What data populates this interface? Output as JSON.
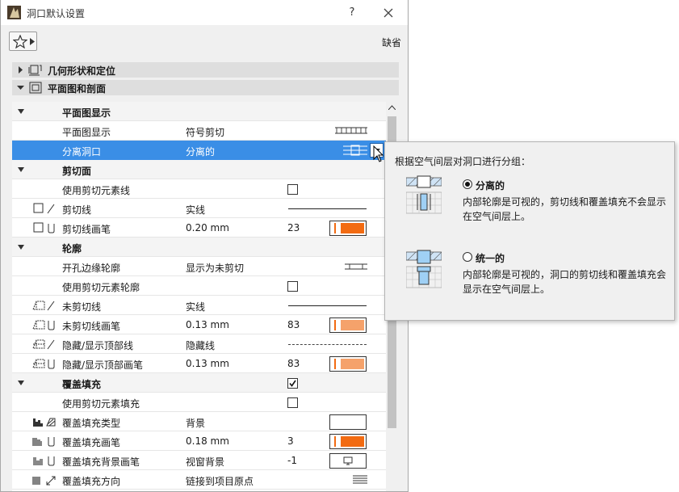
{
  "window": {
    "title": "洞口默认设置",
    "help_label": "?",
    "default_label": "缺省"
  },
  "panels": [
    {
      "label": "几何形状和定位",
      "expanded": false
    },
    {
      "label": "平面图和剖面",
      "expanded": true
    }
  ],
  "rows": [
    {
      "type": "section",
      "label": "平面图显示"
    },
    {
      "type": "item",
      "label": "平面图显示",
      "value": "符号剪切",
      "preview": "plan-symbol"
    },
    {
      "type": "item",
      "label": "分离洞口",
      "value": "分离的",
      "preview": "separate-dropdown",
      "selected": true
    },
    {
      "type": "section",
      "label": "剪切面"
    },
    {
      "type": "item",
      "label": "使用剪切元素线",
      "value": "",
      "checkbox": false
    },
    {
      "type": "item",
      "label": "剪切线",
      "value": "实线",
      "preview": "solid-line",
      "icon": "cut-line-icon"
    },
    {
      "type": "item",
      "label": "剪切线画笔",
      "value": "0.20 mm",
      "pen": "23",
      "swatch": "#f26b12",
      "icon": "cut-pen-icon"
    },
    {
      "type": "section",
      "label": "轮廓"
    },
    {
      "type": "item",
      "label": "开孔边缘轮廓",
      "value": "显示为未剪切",
      "preview": "edge-symbol"
    },
    {
      "type": "item",
      "label": "使用剪切元素轮廓",
      "value": "",
      "checkbox": false
    },
    {
      "type": "item",
      "label": "未剪切线",
      "value": "实线",
      "preview": "solid-line",
      "icon": "uncut-line-icon"
    },
    {
      "type": "item",
      "label": "未剪切线画笔",
      "value": "0.13 mm",
      "pen": "83",
      "swatch": "#f5a26b",
      "icon": "uncut-pen-icon"
    },
    {
      "type": "item",
      "label": "隐藏/显示顶部线",
      "value": "隐藏线",
      "preview": "dashed-line",
      "icon": "overhead-line-icon"
    },
    {
      "type": "item",
      "label": "隐藏/显示顶部画笔",
      "value": "0.13 mm",
      "pen": "83",
      "swatch": "#f5a26b",
      "icon": "overhead-pen-icon"
    },
    {
      "type": "section",
      "label": "覆盖填充",
      "checkbox": true
    },
    {
      "type": "item",
      "label": "使用剪切元素填充",
      "value": "",
      "checkbox": false
    },
    {
      "type": "item",
      "label": "覆盖填充类型",
      "value": "背景",
      "preview": "empty-box",
      "icon": "fill-type-icon"
    },
    {
      "type": "item",
      "label": "覆盖填充画笔",
      "value": "0.18 mm",
      "pen": "3",
      "swatch": "#f26b12",
      "icon": "fill-pen-icon"
    },
    {
      "type": "item",
      "label": "覆盖填充背景画笔",
      "value": "视窗背景",
      "pen": "-1",
      "preview": "window-bg",
      "icon": "fill-bg-pen-icon"
    },
    {
      "type": "item",
      "label": "覆盖填充方向",
      "value": "链接到项目原点",
      "preview": "hatch-lines",
      "icon": "fill-orientation-icon"
    }
  ],
  "popup": {
    "title": "根据空气间层对洞口进行分组：",
    "options": [
      {
        "name": "分离的",
        "desc": "内部轮廓是可视的，剪切线和覆盖填充不会显示在空气间层上。",
        "selected": true
      },
      {
        "name": "统一的",
        "desc": "内部轮廓是可视的，洞口的剪切线和覆盖填充会显示在空气间层上。",
        "selected": false
      }
    ]
  },
  "colors": {
    "selection": "#3a8ee6",
    "accent_pen": "#f26b12",
    "light_pen": "#f5a26b"
  }
}
